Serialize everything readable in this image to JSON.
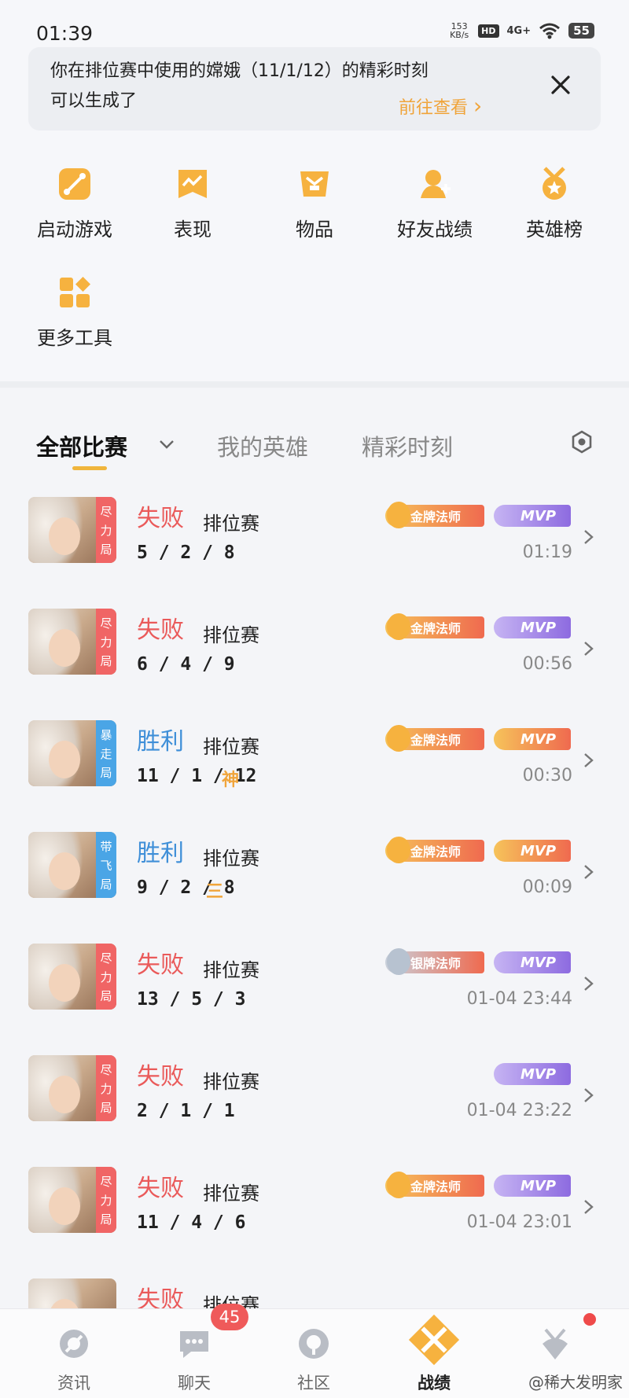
{
  "status_bar": {
    "time": "01:39",
    "net_speed_value": "153",
    "net_speed_unit": "KB/s",
    "hd": "HD",
    "network": "4G+",
    "battery": "55"
  },
  "notice": {
    "line1": "你在排位赛中使用的嫦娥（11/1/12）的精彩时刻",
    "line2": "可以生成了",
    "link": "前往查看 ",
    "link_arrow": "›"
  },
  "tools": [
    {
      "label": "启动游戏",
      "icon": "launch-game-icon"
    },
    {
      "label": "表现",
      "icon": "performance-icon"
    },
    {
      "label": "物品",
      "icon": "items-icon"
    },
    {
      "label": "好友战绩",
      "icon": "friend-record-icon"
    },
    {
      "label": "英雄榜",
      "icon": "hero-rank-icon"
    },
    {
      "label": "更多工具",
      "icon": "more-tools-icon"
    }
  ],
  "tabs": {
    "all": "全部比赛",
    "heroes": "我的英雄",
    "highlights": "精彩时刻"
  },
  "matches": [
    {
      "tag": [
        "尽",
        "力",
        "局"
      ],
      "tag_color": "red",
      "result": "失败",
      "result_type": "lose",
      "mode": "排位赛",
      "kda": "5 / 2 / 8",
      "extra": "",
      "medal": "金牌法师",
      "medal_type": "gold",
      "mvp": "MVP",
      "mvp_type": "purple",
      "time": "01:19"
    },
    {
      "tag": [
        "尽",
        "力",
        "局"
      ],
      "tag_color": "red",
      "result": "失败",
      "result_type": "lose",
      "mode": "排位赛",
      "kda": "6 / 4 / 9",
      "extra": "",
      "medal": "金牌法师",
      "medal_type": "gold",
      "mvp": "MVP",
      "mvp_type": "purple",
      "time": "00:56"
    },
    {
      "tag": [
        "暴",
        "走",
        "局"
      ],
      "tag_color": "blue",
      "result": "胜利",
      "result_type": "win",
      "mode": "排位赛",
      "kda": "11 / 1 / 12",
      "extra": "神",
      "medal": "金牌法师",
      "medal_type": "gold",
      "mvp": "MVP",
      "mvp_type": "gold",
      "time": "00:30"
    },
    {
      "tag": [
        "带",
        "飞",
        "局"
      ],
      "tag_color": "blue",
      "result": "胜利",
      "result_type": "win",
      "mode": "排位赛",
      "kda": "9 / 2 / 8",
      "extra": "三",
      "medal": "金牌法师",
      "medal_type": "gold",
      "mvp": "MVP",
      "mvp_type": "gold",
      "time": "00:09"
    },
    {
      "tag": [
        "尽",
        "力",
        "局"
      ],
      "tag_color": "red",
      "result": "失败",
      "result_type": "lose",
      "mode": "排位赛",
      "kda": "13 / 5 / 3",
      "extra": "",
      "medal": "银牌法师",
      "medal_type": "silver",
      "mvp": "MVP",
      "mvp_type": "purple",
      "time": "01-04  23:44"
    },
    {
      "tag": [
        "尽",
        "力",
        "局"
      ],
      "tag_color": "red",
      "result": "失败",
      "result_type": "lose",
      "mode": "排位赛",
      "kda": "2 / 1 / 1",
      "extra": "",
      "medal": "",
      "medal_type": "none",
      "mvp": "MVP",
      "mvp_type": "purple",
      "time": "01-04  23:22"
    },
    {
      "tag": [
        "尽",
        "力",
        "局"
      ],
      "tag_color": "red",
      "result": "失败",
      "result_type": "lose",
      "mode": "排位赛",
      "kda": "11 / 4 / 6",
      "extra": "",
      "medal": "金牌法师",
      "medal_type": "gold",
      "mvp": "MVP",
      "mvp_type": "purple",
      "time": "01-04  23:01"
    },
    {
      "tag": [
        "",
        "",
        ""
      ],
      "tag_color": "none",
      "result": "失败",
      "result_type": "lose",
      "mode": "排位赛",
      "kda": "",
      "extra": "",
      "medal": "",
      "medal_type": "none",
      "mvp": "",
      "mvp_type": "none",
      "time": ""
    }
  ],
  "bottom_nav": {
    "items": [
      {
        "label": "资讯",
        "icon": "news-icon"
      },
      {
        "label": "聊天",
        "icon": "chat-icon"
      },
      {
        "label": "社区",
        "icon": "community-icon"
      },
      {
        "label": "战绩",
        "icon": "record-icon"
      },
      {
        "label": "",
        "icon": "profile-icon"
      }
    ],
    "chat_badge": "45"
  },
  "watermark": "@稀大发明家",
  "colors": {
    "accent": "#f0b53c",
    "lose": "#ea5a5a",
    "win": "#3f8fd8"
  }
}
